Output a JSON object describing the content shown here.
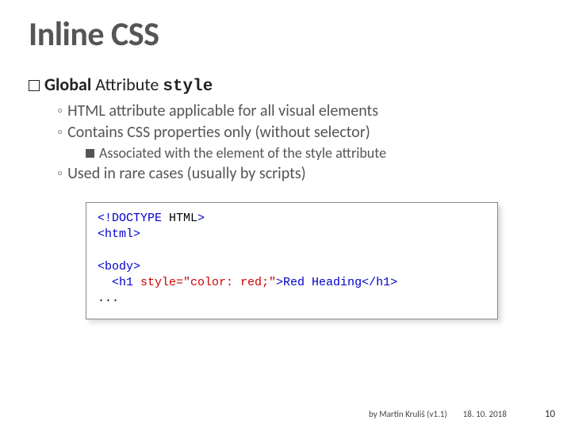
{
  "title": "Inline CSS",
  "main": {
    "label_prefix": "Global",
    "label_rest": " Attribute ",
    "label_code": "style"
  },
  "sub1": "HTML attribute applicable for all visual elements",
  "sub2": "Contains CSS properties only (without selector)",
  "subsub1": "Associated with the element of the style attribute",
  "sub3": "Used in rare cases (usually by scripts)",
  "code": {
    "l1a": "<!DOCTYPE ",
    "l1b": "HTML",
    "l1c": ">",
    "l2a": "<html>",
    "l3": "",
    "l4a": "<body>",
    "l5a": "  <h1 ",
    "l5b": "style=\"color: red;\"",
    "l5c": ">Red Heading</h1>",
    "l6": "..."
  },
  "footer": {
    "author": "by Martin Kruliš (v1.1)",
    "date": "18. 10. 2018",
    "page": "10"
  }
}
